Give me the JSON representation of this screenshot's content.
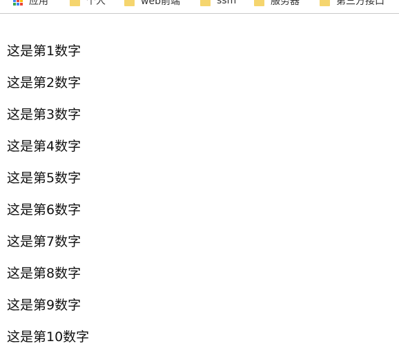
{
  "bookmarks": {
    "apps_colors": [
      "#ea4335",
      "#fbbc05",
      "#34a853",
      "#4285f4",
      "#ea4335",
      "#fbbc05",
      "#34a853",
      "#4285f4",
      "#ea4335"
    ],
    "items": [
      {
        "label": "应用",
        "icon": "apps-icon"
      },
      {
        "label": "个人",
        "icon": "folder-icon"
      },
      {
        "label": "web前端",
        "icon": "folder-icon"
      },
      {
        "label": "ssm",
        "icon": "folder-icon"
      },
      {
        "label": "服务器",
        "icon": "folder-icon"
      },
      {
        "label": "第三方接口",
        "icon": "folder-icon"
      }
    ]
  },
  "content": {
    "lines": [
      "这是第1数字",
      "这是第2数字",
      "这是第3数字",
      "这是第4数字",
      "这是第5数字",
      "这是第6数字",
      "这是第7数字",
      "这是第8数字",
      "这是第9数字",
      "这是第10数字"
    ]
  }
}
